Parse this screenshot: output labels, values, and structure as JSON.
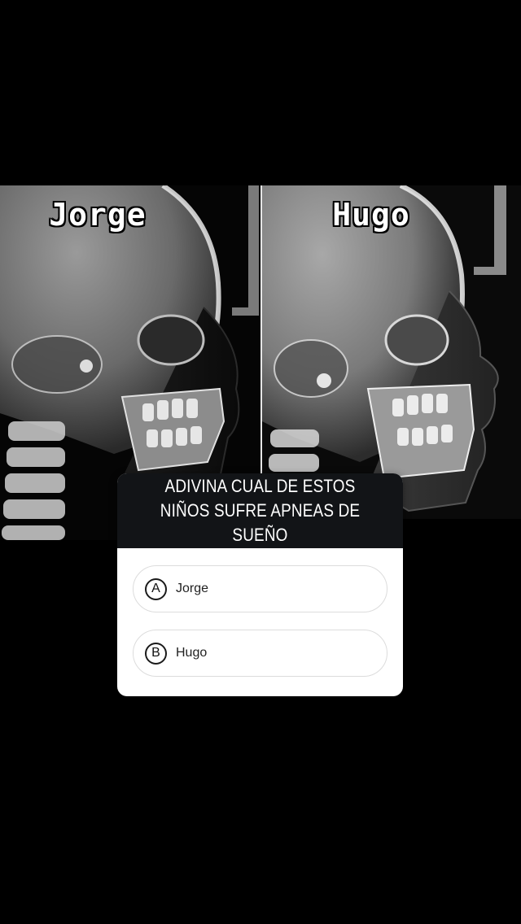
{
  "image": {
    "left_name": "Jorge",
    "right_name": "Hugo"
  },
  "quiz": {
    "question": "ADIVINA CUAL DE ESTOS NIÑOS SUFRE APNEAS DE SUEÑO",
    "options": [
      {
        "letter": "A",
        "text": "Jorge"
      },
      {
        "letter": "B",
        "text": "Hugo"
      }
    ]
  },
  "colors": {
    "background": "#000000",
    "quiz_header": "#121417",
    "quiz_body": "#ffffff",
    "option_border": "#dcdcdc"
  }
}
